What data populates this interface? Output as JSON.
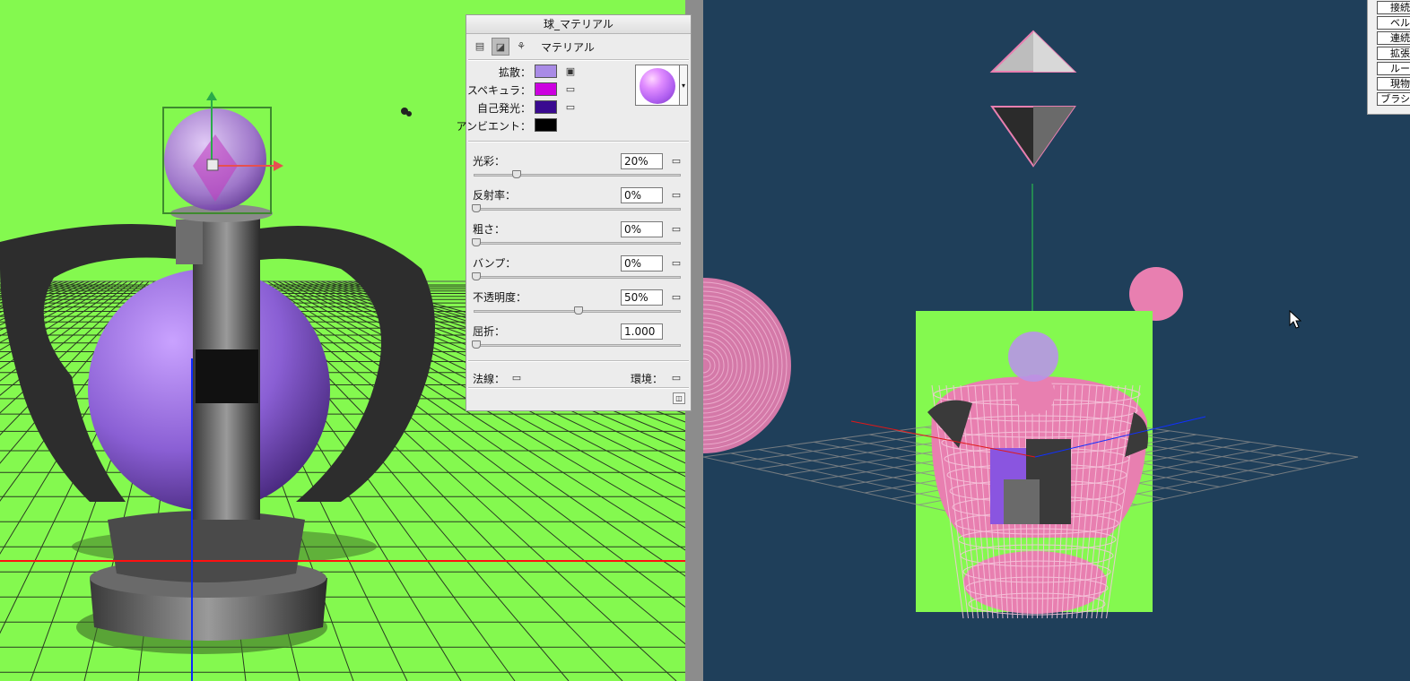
{
  "panel": {
    "title": "球_マテリアル",
    "tab_label": "マテリアル",
    "colors": [
      {
        "label": "拡散：",
        "color": "#a98be6"
      },
      {
        "label": "スペキュラ：",
        "color": "#cc00e0"
      },
      {
        "label": "自己発光：",
        "color": "#3a0a90"
      },
      {
        "label": "アンビエント：",
        "color": "#000000"
      }
    ],
    "params": [
      {
        "label": "光彩：",
        "value": "20%",
        "level": 0.2
      },
      {
        "label": "反射率：",
        "value": "0%",
        "level": 0
      },
      {
        "label": "粗さ：",
        "value": "0%",
        "level": 0
      },
      {
        "label": "バンプ：",
        "value": "0%",
        "level": 0
      },
      {
        "label": "不透明度：",
        "value": "50%",
        "level": 0.5
      },
      {
        "label": "屈折：",
        "value": "1.000",
        "level": 0
      }
    ],
    "normal_label": "法線：",
    "environment_label": "環境："
  },
  "side_menu": {
    "items": [
      "接続",
      "ベル",
      "連続",
      "拡張",
      "ルー",
      "現物",
      "ブラシ"
    ]
  },
  "theme": {
    "viewport_green": "#84f94f",
    "viewport_blue": "#1f3f5a",
    "wire_pink": "#e87fb0",
    "sphere_purple": "#9a6fd8"
  }
}
